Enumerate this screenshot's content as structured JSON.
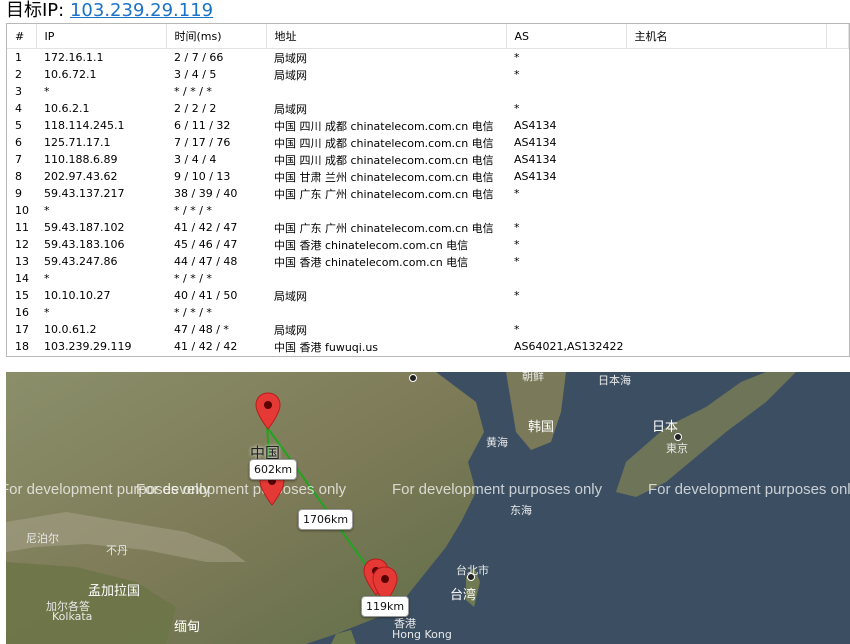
{
  "header": {
    "label": "目标IP:",
    "ip": "103.239.29.119"
  },
  "table": {
    "columns": [
      "#",
      "IP",
      "时间(ms)",
      "地址",
      "AS",
      "主机名"
    ],
    "rows": [
      [
        "1",
        "172.16.1.1",
        "2 / 7 / 66",
        "局域网",
        "*",
        ""
      ],
      [
        "2",
        "10.6.72.1",
        "3 / 4 / 5",
        "局域网",
        "*",
        ""
      ],
      [
        "3",
        "*",
        "* / * / *",
        "",
        "",
        ""
      ],
      [
        "4",
        "10.6.2.1",
        "2 / 2 / 2",
        "局域网",
        "*",
        ""
      ],
      [
        "5",
        "118.114.245.1",
        "6 / 11 / 32",
        "中国 四川 成都 chinatelecom.com.cn 电信",
        "AS4134",
        ""
      ],
      [
        "6",
        "125.71.17.1",
        "7 / 17 / 76",
        "中国 四川 成都 chinatelecom.com.cn 电信",
        "AS4134",
        ""
      ],
      [
        "7",
        "110.188.6.89",
        "3 / 4 / 4",
        "中国 四川 成都 chinatelecom.com.cn 电信",
        "AS4134",
        ""
      ],
      [
        "8",
        "202.97.43.62",
        "9 / 10 / 13",
        "中国 甘肃 兰州 chinatelecom.com.cn 电信",
        "AS4134",
        ""
      ],
      [
        "9",
        "59.43.137.217",
        "38 / 39 / 40",
        "中国 广东 广州 chinatelecom.com.cn 电信",
        "*",
        ""
      ],
      [
        "10",
        "*",
        "* / * / *",
        "",
        "",
        ""
      ],
      [
        "11",
        "59.43.187.102",
        "41 / 42 / 47",
        "中国 广东 广州 chinatelecom.com.cn 电信",
        "*",
        ""
      ],
      [
        "12",
        "59.43.183.106",
        "45 / 46 / 47",
        "中国 香港 chinatelecom.com.cn 电信",
        "*",
        ""
      ],
      [
        "13",
        "59.43.247.86",
        "44 / 47 / 48",
        "中国 香港 chinatelecom.com.cn 电信",
        "*",
        ""
      ],
      [
        "14",
        "*",
        "* / * / *",
        "",
        "",
        ""
      ],
      [
        "15",
        "10.10.10.27",
        "40 / 41 / 50",
        "局域网",
        "*",
        ""
      ],
      [
        "16",
        "*",
        "* / * / *",
        "",
        "",
        ""
      ],
      [
        "17",
        "10.0.61.2",
        "47 / 48 / *",
        "局域网",
        "*",
        ""
      ],
      [
        "18",
        "103.239.29.119",
        "41 / 42 / 42",
        "中国 香港 fuwuqi.us",
        "AS64021,AS132422",
        ""
      ]
    ]
  },
  "map": {
    "watermark": "For development purposes only",
    "distances": [
      "602km",
      "1706km",
      "119km"
    ],
    "labels": {
      "china": "中国",
      "korea": "韩国",
      "japan": "日本",
      "tokyo": "東京",
      "yellow_sea": "黄海",
      "east_sea": "东海",
      "japan_sea": "日本海",
      "nepal": "尼泊尔",
      "bhutan": "不丹",
      "bangladesh": "孟加拉国",
      "kolkata_cn": "加尔各答",
      "kolkata": "Kolkata",
      "myanmar": "缅甸",
      "taipei": "台北市",
      "taiwan": "台湾",
      "hk_cn": "香港",
      "hk": "Hong Kong",
      "partial_top": "朝鲜"
    },
    "colors": {
      "route": "#1fa51f",
      "pin": "#e53935",
      "water": "#3c4f62"
    }
  }
}
